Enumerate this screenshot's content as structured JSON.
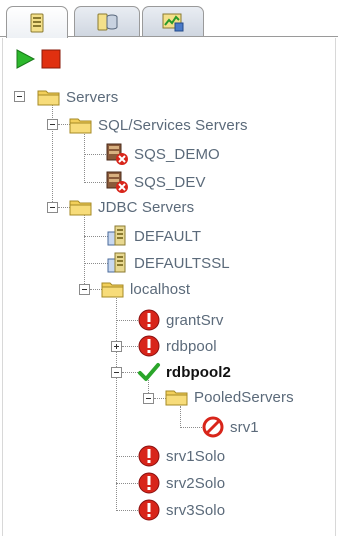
{
  "tabs": [
    {
      "icon": "server-tab-icon",
      "active": true
    },
    {
      "icon": "database-tab-icon",
      "active": false
    },
    {
      "icon": "monitor-tab-icon",
      "active": false
    }
  ],
  "toolbar": {
    "start_icon": "play-icon",
    "stop_icon": "stop-icon",
    "start_color": "#2db82d",
    "stop_color": "#e03010"
  },
  "tree": {
    "root": {
      "label": "Servers"
    },
    "sql_group": {
      "label": "SQL/Services Servers"
    },
    "sql_items": [
      {
        "label": "SQS_DEMO"
      },
      {
        "label": "SQS_DEV"
      }
    ],
    "jdbc_group": {
      "label": "JDBC Servers"
    },
    "jdbc_items": [
      {
        "label": "DEFAULT"
      },
      {
        "label": "DEFAULTSSL"
      }
    ],
    "localhost": {
      "label": "localhost"
    },
    "local_items": [
      {
        "label": "grantSrv"
      },
      {
        "label": "rdbpool"
      },
      {
        "label": "rdbpool2"
      }
    ],
    "pooled": {
      "label": "PooledServers"
    },
    "pooled_items": [
      {
        "label": "srv1"
      }
    ],
    "solo_items": [
      {
        "label": "srv1Solo"
      },
      {
        "label": "srv2Solo"
      },
      {
        "label": "srv3Solo"
      }
    ]
  },
  "colors": {
    "error_red": "#d8251a",
    "ok_green": "#2aa52a",
    "folder_yellow": "#f2cf5a",
    "label_gray": "#5b6a7a"
  }
}
